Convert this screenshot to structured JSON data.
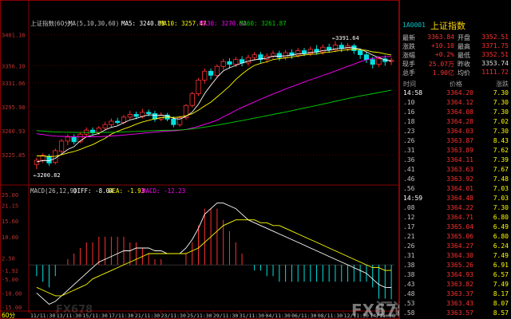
{
  "chart_header": {
    "title": "上证指数(60分)",
    "ma_label": "MA(5,10,30,60)",
    "ma5": "MA5: 3240.83",
    "ma10": "MA10: 3257.47",
    "ma30": "MA30: 3270.63",
    "ma60": "MA60: 3261.87"
  },
  "price_axis": [
    "3401.18",
    "3356.10",
    "3331.06",
    "3295.98",
    "3260.93",
    "3225.85"
  ],
  "annotations": {
    "high": "3391.64",
    "low": "3200.82"
  },
  "macd_header": {
    "label": "MACD(26,12,9)",
    "diff": "DIFF: -8.04",
    "dea": "DEA: -1.93",
    "macd": "MACD: -12.23"
  },
  "macd_axis": [
    "25.00",
    "21.15",
    "15.60",
    "10.00",
    "2.50",
    "-1.92",
    "-5.00",
    "-10.00",
    "-15.00"
  ],
  "period_label": "60分",
  "time_axis": [
    "11/11:30",
    "13/11:30",
    "15/11:30",
    "17/11:30",
    "21/11:30",
    "23/11:30",
    "25/11:30",
    "29/11:30",
    "31/11:30",
    "04/11:30",
    "06/11:30",
    "08/11:30",
    "12/11:30",
    "14/11:30"
  ],
  "colors": {
    "up": "#ff3030",
    "down": "#00e0e0",
    "ma5": "#ffffff",
    "ma10": "#ffff00",
    "ma30": "#ff00ff",
    "ma60": "#00d000",
    "frame": "#8b0000"
  },
  "quote_panel": {
    "code": "1A0001",
    "name": "上证指数",
    "rows": [
      {
        "l1": "最新",
        "v1": "3363.84",
        "c1": "red",
        "l2": "开盘",
        "v2": "3352.51",
        "c2": "red"
      },
      {
        "l1": "涨跌",
        "v1": "+10.10",
        "c1": "red",
        "l2": "最高",
        "v2": "3371.75",
        "c2": "red"
      },
      {
        "l1": "涨幅",
        "v1": "+0.2%",
        "c1": "red",
        "l2": "最低",
        "v2": "3352.51",
        "c2": "red"
      },
      {
        "l1": "现手",
        "v1": "25.07万",
        "c1": "red",
        "l2": "昨收",
        "v2": "3353.74",
        "c2": "white"
      },
      {
        "l1": "总手",
        "v1": "1.90亿",
        "c1": "red",
        "l2": "均价",
        "v2": "1111.72",
        "c2": "red"
      }
    ],
    "table_headers": {
      "time": "时间",
      "price": "价格",
      "vol": "涨跌"
    },
    "ticks": [
      {
        "t": "14:58",
        "p": "3364.20",
        "v": "7.30"
      },
      {
        "t": ".10",
        "p": "3364.12",
        "v": "7.30"
      },
      {
        "t": ".16",
        "p": "3364.08",
        "v": "7.30"
      },
      {
        "t": ".18",
        "p": "3364.28",
        "v": "7.02"
      },
      {
        "t": ".23",
        "p": "3364.03",
        "v": "7.30"
      },
      {
        "t": ".26",
        "p": "3363.87",
        "v": "8.43"
      },
      {
        "t": ".31",
        "p": "3363.89",
        "v": "7.62"
      },
      {
        "t": ".36",
        "p": "3364.11",
        "v": "7.39"
      },
      {
        "t": ".41",
        "p": "3363.63",
        "v": "7.67"
      },
      {
        "t": ".46",
        "p": "3363.92",
        "v": "7.48"
      },
      {
        "t": ".56",
        "p": "3364.01",
        "v": "7.03"
      },
      {
        "t": "14:59",
        "p": "3364.48",
        "v": "7.03"
      },
      {
        "t": ".08",
        "p": "3364.22",
        "v": "7.30"
      },
      {
        "t": ".12",
        "p": "3364.71",
        "v": "6.80"
      },
      {
        "t": ".17",
        "p": "3365.04",
        "v": "6.49"
      },
      {
        "t": ".21",
        "p": "3365.06",
        "v": "6.80"
      },
      {
        "t": ".26",
        "p": "3364.27",
        "v": "6.24"
      },
      {
        "t": ".31",
        "p": "3364.30",
        "v": "7.49"
      },
      {
        "t": ".38",
        "p": "3365.26",
        "v": "6.91"
      },
      {
        "t": ".38",
        "p": "3364.93",
        "v": "6.57"
      },
      {
        "t": ".43",
        "p": "3363.82",
        "v": "7.49"
      },
      {
        "t": ".48",
        "p": "3363.37",
        "v": "8.17"
      },
      {
        "t": ".53",
        "p": "3363.43",
        "v": "8.07"
      },
      {
        "t": ".58",
        "p": "3363.57",
        "v": "8.57"
      }
    ]
  },
  "watermarks": [
    "FX678",
    "汇通网",
    "FX678"
  ],
  "chart_data": {
    "type": "candlestick",
    "title": "上证指数(60分)",
    "ylim": [
      3190,
      3410
    ],
    "series": [
      {
        "name": "K",
        "ohlc": [
          [
            3212,
            3218,
            3205,
            3222
          ],
          [
            3218,
            3225,
            3214,
            3228
          ],
          [
            3224,
            3214,
            3210,
            3227
          ],
          [
            3215,
            3232,
            3212,
            3235
          ],
          [
            3231,
            3246,
            3228,
            3249
          ],
          [
            3246,
            3252,
            3240,
            3256
          ],
          [
            3252,
            3245,
            3241,
            3256
          ],
          [
            3245,
            3256,
            3243,
            3259
          ],
          [
            3256,
            3262,
            3252,
            3266
          ],
          [
            3262,
            3258,
            3254,
            3266
          ],
          [
            3258,
            3265,
            3255,
            3268
          ],
          [
            3265,
            3270,
            3262,
            3274
          ],
          [
            3270,
            3275,
            3266,
            3279
          ],
          [
            3275,
            3273,
            3270,
            3280
          ],
          [
            3273,
            3281,
            3270,
            3284
          ],
          [
            3281,
            3285,
            3278,
            3290
          ],
          [
            3285,
            3282,
            3278,
            3289
          ],
          [
            3282,
            3288,
            3279,
            3293
          ],
          [
            3288,
            3286,
            3282,
            3292
          ],
          [
            3286,
            3278,
            3274,
            3290
          ],
          [
            3278,
            3284,
            3275,
            3288
          ],
          [
            3284,
            3278,
            3275,
            3287
          ],
          [
            3278,
            3270,
            3266,
            3282
          ],
          [
            3270,
            3280,
            3267,
            3283
          ],
          [
            3280,
            3298,
            3277,
            3300
          ],
          [
            3298,
            3315,
            3295,
            3318
          ],
          [
            3315,
            3335,
            3312,
            3338
          ],
          [
            3335,
            3348,
            3330,
            3352
          ],
          [
            3348,
            3342,
            3336,
            3352
          ],
          [
            3342,
            3355,
            3338,
            3358
          ],
          [
            3355,
            3362,
            3350,
            3366
          ],
          [
            3362,
            3358,
            3352,
            3367
          ],
          [
            3358,
            3365,
            3354,
            3369
          ],
          [
            3365,
            3360,
            3355,
            3370
          ],
          [
            3360,
            3368,
            3356,
            3372
          ],
          [
            3368,
            3372,
            3364,
            3376
          ],
          [
            3372,
            3365,
            3360,
            3376
          ],
          [
            3365,
            3370,
            3360,
            3374
          ],
          [
            3370,
            3374,
            3366,
            3378
          ],
          [
            3374,
            3368,
            3363,
            3378
          ],
          [
            3368,
            3375,
            3364,
            3379
          ],
          [
            3375,
            3371,
            3366,
            3380
          ],
          [
            3371,
            3378,
            3368,
            3382
          ],
          [
            3378,
            3374,
            3370,
            3382
          ],
          [
            3374,
            3380,
            3370,
            3384
          ],
          [
            3380,
            3376,
            3372,
            3386
          ],
          [
            3376,
            3383,
            3372,
            3387
          ],
          [
            3383,
            3379,
            3375,
            3388
          ],
          [
            3379,
            3386,
            3376,
            3391.64
          ],
          [
            3386,
            3381,
            3376,
            3390
          ],
          [
            3381,
            3385,
            3377,
            3389
          ],
          [
            3385,
            3378,
            3373,
            3388
          ],
          [
            3378,
            3372,
            3366,
            3381
          ],
          [
            3372,
            3365,
            3360,
            3376
          ],
          [
            3365,
            3358,
            3352,
            3369
          ],
          [
            3358,
            3366,
            3354,
            3370
          ],
          [
            3366,
            3362,
            3356,
            3371
          ],
          [
            3362,
            3364,
            3357,
            3368
          ]
        ]
      }
    ],
    "macd": {
      "diff": [
        -10,
        -12,
        -14,
        -13,
        -11,
        -9,
        -7,
        -5,
        -3,
        -1,
        1,
        2,
        3,
        4,
        5,
        5,
        6,
        6,
        6,
        5,
        5,
        4,
        4,
        4,
        6,
        9,
        13,
        18,
        20,
        22,
        22,
        21,
        20,
        18,
        16,
        15,
        14,
        13,
        12,
        11,
        10,
        9,
        8,
        7,
        6,
        5,
        4,
        3,
        2,
        1,
        0,
        -1,
        -2,
        -3,
        -5,
        -7,
        -8,
        -8.04
      ],
      "dea": [
        -8,
        -9,
        -10,
        -11,
        -11,
        -10,
        -9,
        -8,
        -7,
        -5,
        -4,
        -3,
        -2,
        -1,
        0,
        1,
        2,
        3,
        4,
        4,
        4,
        4,
        4,
        4,
        4,
        5,
        6,
        8,
        10,
        12,
        14,
        15,
        16,
        16,
        16,
        16,
        15,
        15,
        14,
        14,
        13,
        12,
        11,
        10,
        9,
        8,
        7,
        6,
        5,
        4,
        3,
        2,
        1,
        0,
        -1,
        -1,
        -2,
        -1.93
      ]
    }
  }
}
